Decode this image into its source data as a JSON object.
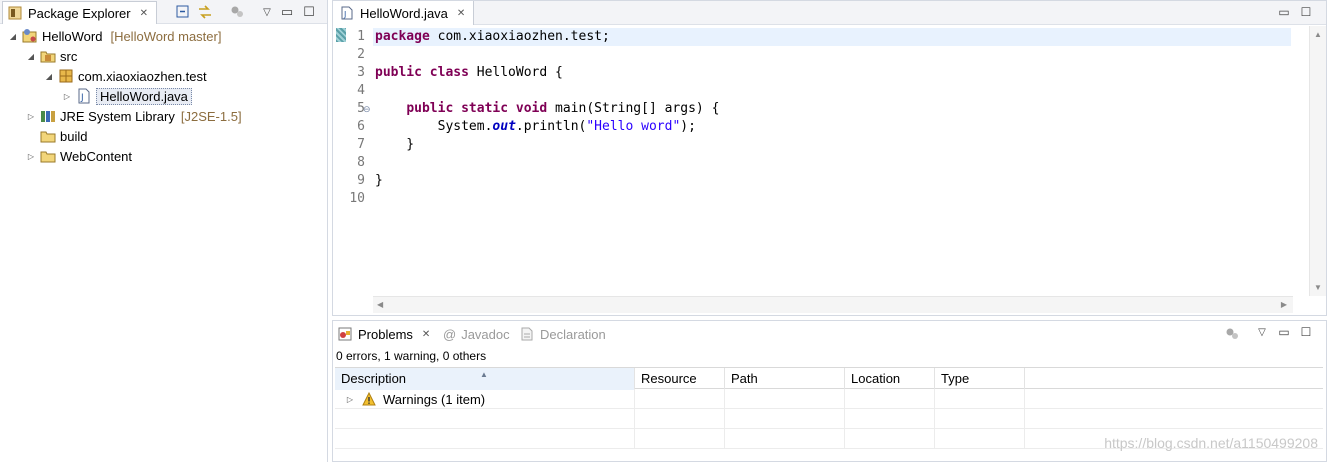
{
  "package_explorer": {
    "tab_title": "Package Explorer",
    "tree": [
      {
        "label": "HelloWord",
        "decoration": "[HelloWord master]",
        "icon": "project-icon"
      },
      {
        "label": "src",
        "icon": "source-folder-icon"
      },
      {
        "label": "com.xiaoxiaozhen.test",
        "icon": "package-icon"
      },
      {
        "label": "HelloWord.java",
        "icon": "java-file-icon"
      },
      {
        "label": "JRE System Library",
        "decoration": "[J2SE-1.5]",
        "icon": "library-icon"
      },
      {
        "label": "build",
        "icon": "folder-icon"
      },
      {
        "label": "WebContent",
        "icon": "folder-icon"
      }
    ]
  },
  "editor": {
    "tab_title": "HelloWord.java",
    "line_numbers": [
      "1",
      "2",
      "3",
      "4",
      "5",
      "6",
      "7",
      "8",
      "9",
      "10"
    ],
    "lines": [
      {
        "kw": "package",
        "rest": " com.xiaoxiaozhen.test;"
      },
      {
        "kw": "public class",
        "rest": " HelloWord {"
      },
      {
        "indent": "    ",
        "kw": "public static void",
        "rest": " main(String[] args) {"
      },
      {
        "indent": "        ",
        "pre": "System.",
        "field": "out",
        "mid": ".println(",
        "str": "\"Hello word\"",
        "post": ");"
      },
      {
        "text": "    }"
      },
      {
        "text": "}"
      }
    ]
  },
  "problems": {
    "tabs": [
      "Problems",
      "Javadoc",
      "Declaration"
    ],
    "summary": "0 errors, 1 warning, 0 others",
    "columns": [
      "Description",
      "Resource",
      "Path",
      "Location",
      "Type"
    ],
    "rows": [
      {
        "description": "Warnings (1 item)"
      }
    ]
  },
  "watermark": "https://blog.csdn.net/a1150499208",
  "colors": {
    "keyword": "#7f0055",
    "string": "#2a00ff",
    "static_field": "#0000c0",
    "line_number": "#787878"
  }
}
